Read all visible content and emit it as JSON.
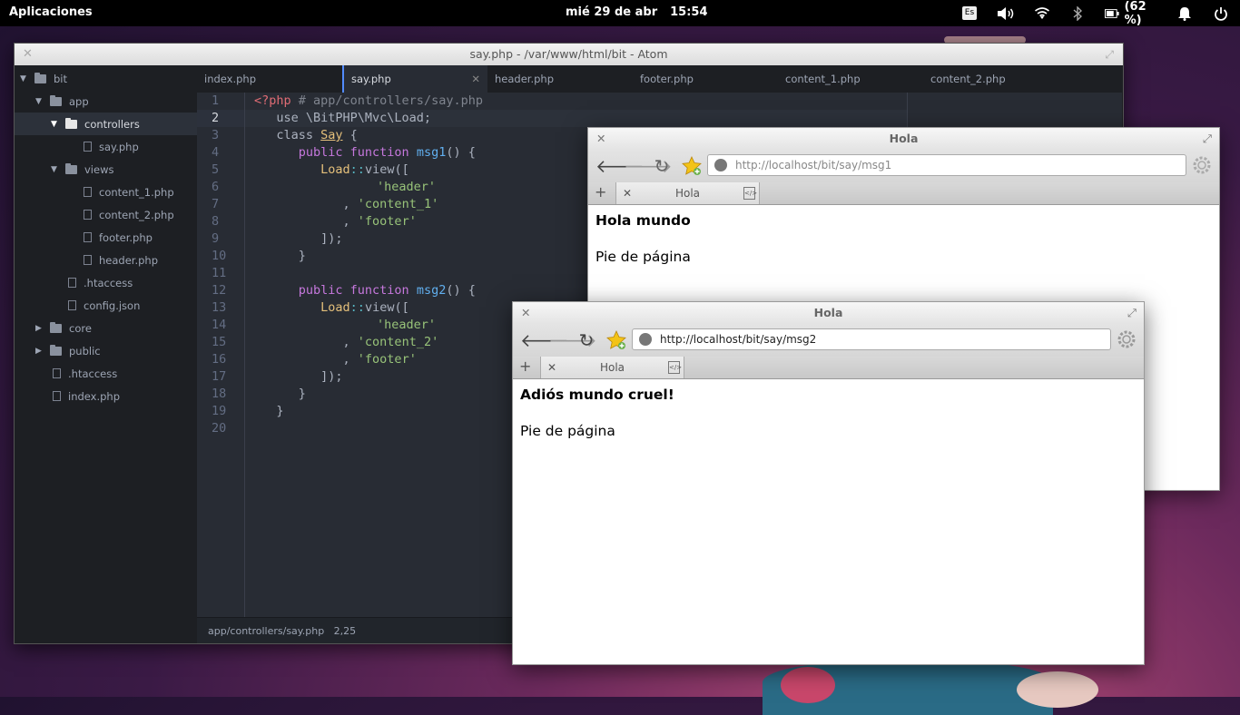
{
  "topbar": {
    "apps_label": "Aplicaciones",
    "date": "mié 29 de abr",
    "time": "15:54",
    "lang": "Es",
    "battery": "(62 %)"
  },
  "atom": {
    "title": "say.php - /var/www/html/bit - Atom",
    "tree": [
      {
        "label": "bit"
      },
      {
        "label": "app"
      },
      {
        "label": "controllers"
      },
      {
        "label": "say.php"
      },
      {
        "label": "views"
      },
      {
        "label": "content_1.php"
      },
      {
        "label": "content_2.php"
      },
      {
        "label": "footer.php"
      },
      {
        "label": "header.php"
      },
      {
        "label": ".htaccess"
      },
      {
        "label": "config.json"
      },
      {
        "label": "core"
      },
      {
        "label": "public"
      },
      {
        "label": ".htaccess"
      },
      {
        "label": "index.php"
      }
    ],
    "tabs": [
      "index.php",
      "say.php",
      "header.php",
      "footer.php",
      "content_1.php",
      "content_2.php"
    ],
    "line_numbers": [
      "1",
      "2",
      "3",
      "4",
      "5",
      "6",
      "7",
      "8",
      "9",
      "10",
      "11",
      "12",
      "13",
      "14",
      "15",
      "16",
      "17",
      "18",
      "19",
      "20"
    ],
    "code": {
      "l1a": "<?php",
      "l1b": " # app/controllers/say.php",
      "l2": "   use \\BitPHP\\Mvc\\Load;",
      "l3a": "   class ",
      "l3b": "Say",
      "l3c": " {",
      "l4a": "      public function ",
      "l4b": "msg1",
      "l4c": "() {",
      "l5a": "         Load",
      "l5b": "::",
      "l5c": "view([",
      "l6": "'header'",
      "l7a": "            , ",
      "l7b": "'content_1'",
      "l8a": "            , ",
      "l8b": "'footer'",
      "l9": "         ]);",
      "l10": "      }",
      "l12a": "      public function ",
      "l12b": "msg2",
      "l12c": "() {",
      "l13a": "         Load",
      "l13b": "::",
      "l13c": "view([",
      "l14": "'header'",
      "l15a": "            , ",
      "l15b": "'content_2'",
      "l16a": "            , ",
      "l16b": "'footer'",
      "l17": "         ]);",
      "l18": "      }",
      "l19": "   }"
    },
    "status_path": "app/controllers/say.php",
    "status_cursor": "2,25"
  },
  "browser1": {
    "title": "Hola",
    "url": "http://localhost/bit/say/msg1",
    "tab": "Hola",
    "heading": "Hola mundo",
    "body": "Pie de página"
  },
  "browser2": {
    "title": "Hola",
    "url": "http://localhost/bit/say/msg2",
    "tab": "Hola",
    "heading": "Adiós mundo cruel!",
    "body": "Pie de página"
  }
}
